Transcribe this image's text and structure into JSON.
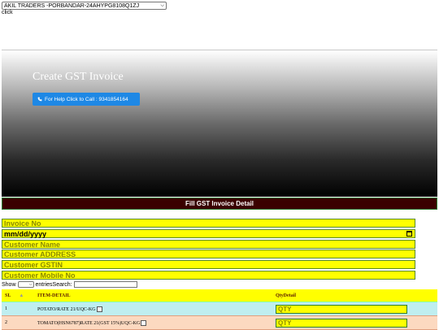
{
  "store_select": {
    "value": "AKIL TRADERS -PORBANDAR-24AHYPG8108Q1ZJ"
  },
  "click_label": "click",
  "hero": {
    "title": "Create GST Invoice",
    "help_button": "For Help Click to Call : 9341854164",
    "icon": "phone-icon"
  },
  "section_title": "Fill GST Invoice Detail",
  "form": {
    "invoice_no": "Invoice No",
    "date": "mm/dd/yyyy",
    "customer_name": "Customer Name",
    "customer_address": "Customer ADDRESS",
    "customer_gstin": "Customer GSTIN",
    "customer_mobile": "Customer Mobile No"
  },
  "table_controls": {
    "show": "Show",
    "entries_search": "entriesSearch:"
  },
  "table": {
    "headers": {
      "sl": "SL",
      "item": "ITEM-DETAIL",
      "qty": "QtyDetail"
    },
    "rows": [
      {
        "sl": "1",
        "item": "POTATO/RATE 21/UQC-KG",
        "qty_placeholder": "QTY"
      },
      {
        "sl": "2",
        "item": "TOMATO(HSN6787)RATE 21(GST 15%)UQC-KG",
        "qty_placeholder": "QTY"
      }
    ]
  },
  "colors": {
    "field_bg": "#ffff00",
    "button": "#1e88e5",
    "section_bar": "#3a0000",
    "row1": "#bfeef0",
    "row2": "#fcd9c0"
  }
}
